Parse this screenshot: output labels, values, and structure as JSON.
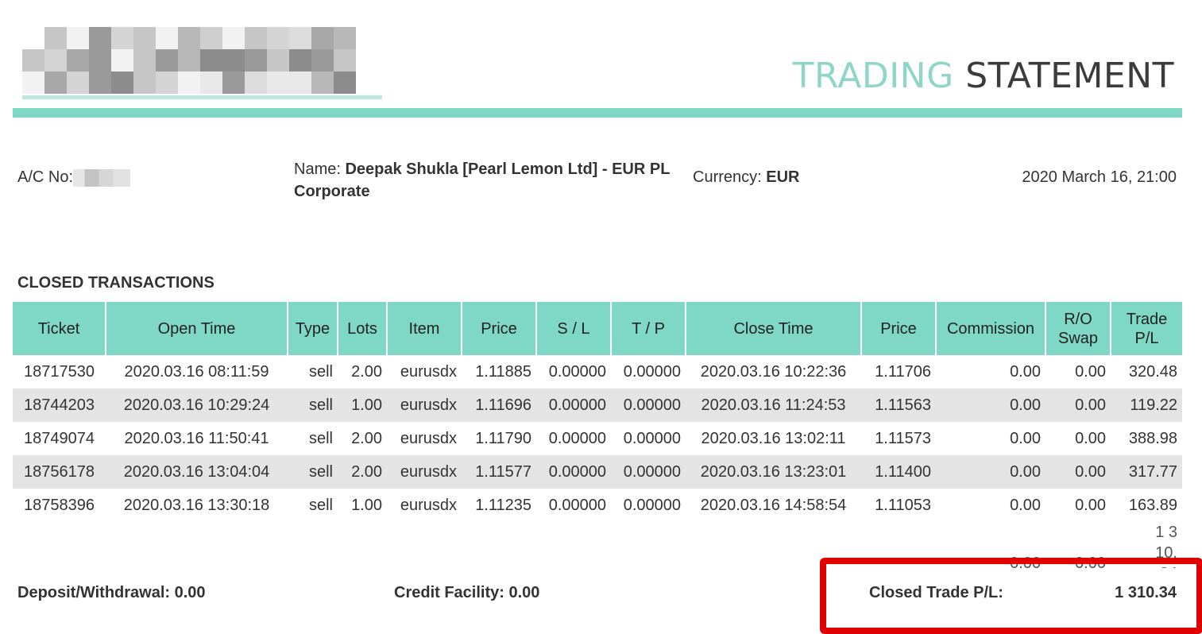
{
  "header": {
    "title_light": "TRADING ",
    "title_dark": "STATEMENT"
  },
  "colors": {
    "accent": "#7fd8c6",
    "highlight_border": "#e00000",
    "alt_row": "#e4e4e4"
  },
  "account": {
    "acno_label": "A/C No:",
    "name_label": "Name:",
    "name_value": "Deepak Shukla [Pearl Lemon Ltd] - EUR PL",
    "name_value_line2": "Corporate",
    "currency_label": "Currency:",
    "currency_value": "EUR",
    "statement_date": "2020 March 16, 21:00"
  },
  "closed": {
    "title": "CLOSED TRANSACTIONS",
    "columns": [
      "Ticket",
      "Open Time",
      "Type",
      "Lots",
      "Item",
      "Price",
      "S / L",
      "T / P",
      "Close Time",
      "Price",
      "Commission",
      "R/O Swap",
      "Trade P/L"
    ],
    "rows": [
      [
        "18717530",
        "2020.03.16 08:11:59",
        "sell",
        "2.00",
        "eurusdx",
        "1.11885",
        "0.00000",
        "0.00000",
        "2020.03.16 10:22:36",
        "1.11706",
        "0.00",
        "0.00",
        "320.48"
      ],
      [
        "18744203",
        "2020.03.16 10:29:24",
        "sell",
        "1.00",
        "eurusdx",
        "1.11696",
        "0.00000",
        "0.00000",
        "2020.03.16 11:24:53",
        "1.11563",
        "0.00",
        "0.00",
        "119.22"
      ],
      [
        "18749074",
        "2020.03.16 11:50:41",
        "sell",
        "2.00",
        "eurusdx",
        "1.11790",
        "0.00000",
        "0.00000",
        "2020.03.16 13:02:11",
        "1.11573",
        "0.00",
        "0.00",
        "388.98"
      ],
      [
        "18756178",
        "2020.03.16 13:04:04",
        "sell",
        "2.00",
        "eurusdx",
        "1.11577",
        "0.00000",
        "0.00000",
        "2020.03.16 13:23:01",
        "1.11400",
        "0.00",
        "0.00",
        "317.77"
      ],
      [
        "18758396",
        "2020.03.16 13:30:18",
        "sell",
        "1.00",
        "eurusdx",
        "1.11235",
        "0.00000",
        "0.00000",
        "2020.03.16 14:58:54",
        "1.11053",
        "0.00",
        "0.00",
        "163.89"
      ]
    ],
    "totals": {
      "commission": "0.00",
      "swap": "0.00",
      "trade_pl": "1 310.34"
    }
  },
  "summary": {
    "deposit_withdrawal": "Deposit/Withdrawal: 0.00",
    "credit_facility": "Credit Facility: 0.00",
    "closed_trade_pl_label": "Closed Trade P/L:",
    "closed_trade_pl_value": "1 310.34"
  }
}
